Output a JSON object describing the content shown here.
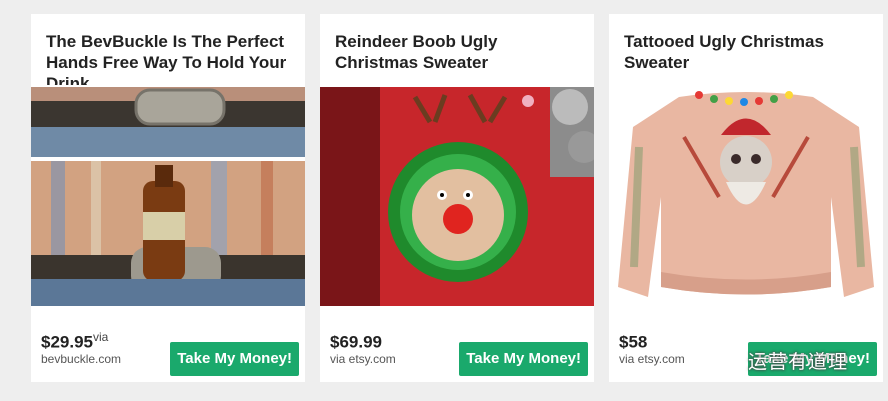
{
  "cards": [
    {
      "title": "The BevBuckle Is The Perfect Hands Free Way To Hold Your Drink",
      "price": "$29.95",
      "price_suffix": "via",
      "seller": "bevbuckle.com",
      "button": "Take My Money!"
    },
    {
      "title": "Reindeer Boob Ugly Christmas Sweater",
      "price": "$69.99",
      "price_suffix": "",
      "seller": "via etsy.com",
      "button": "Take My Money!"
    },
    {
      "title": "Tattooed Ugly Christmas Sweater",
      "price": "$58",
      "price_suffix": "",
      "seller": "via etsy.com",
      "button": "Take My Money!"
    }
  ],
  "watermark": {
    "text": "运营有道理",
    "icon": "wechat-icon"
  },
  "colors": {
    "button": "#1aa96c",
    "background": "#eeeeee"
  }
}
